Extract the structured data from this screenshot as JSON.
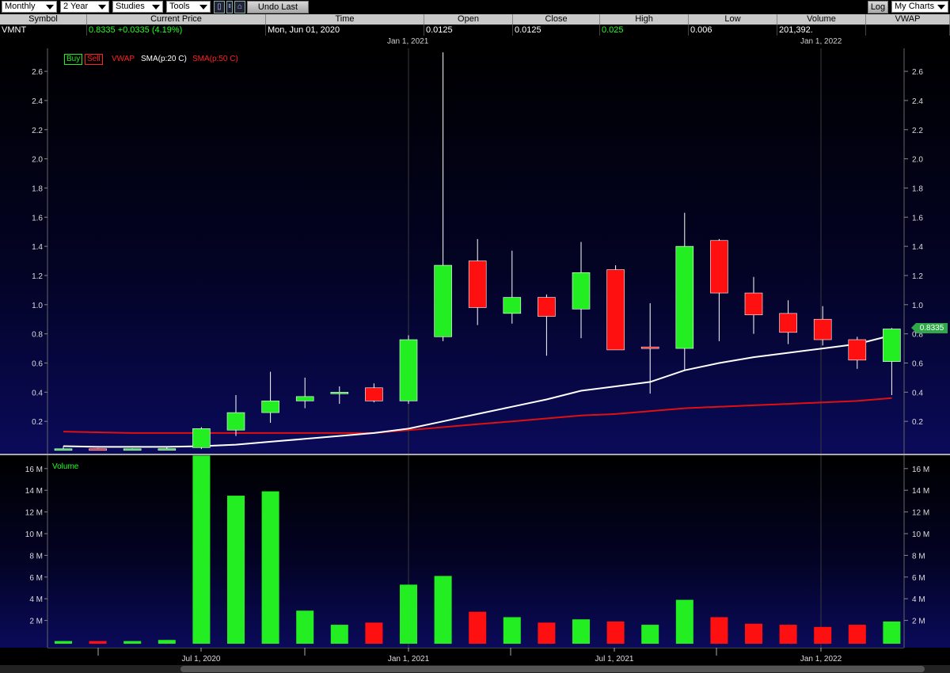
{
  "toolbar": {
    "period": "Monthly",
    "range": "2 Year",
    "studies": "Studies",
    "tools": "Tools",
    "undo": "Undo Last",
    "log": "Log",
    "my_charts": "My Charts"
  },
  "quote": {
    "headers": [
      "Symbol",
      "Current Price",
      "Time",
      "Open",
      "Close",
      "High",
      "Low",
      "Volume",
      "VWAP"
    ],
    "symbol": "VMNT",
    "current_price": "0.8335  +0.0335 (4.19%)",
    "time": "Mon, Jun 01, 2020",
    "open": "0.0125",
    "close": "0.0125",
    "high": "0.025",
    "low": "0.006",
    "volume": "201,392.",
    "vwap": ""
  },
  "legend": {
    "buy": "Buy",
    "sell": "Sell",
    "vwap": "VWAP",
    "sma20": "SMA(p:20 C)",
    "sma50": "SMA(p:50 C)",
    "volume": "Volume"
  },
  "price_tag": "0.8335",
  "top_dates": [
    "Jan 1, 2021",
    "Jan 1, 2022"
  ],
  "bottom_dates": [
    "Jul 1, 2020",
    "Jan 1, 2021",
    "Jul 1, 2021",
    "Jan 1, 2022"
  ],
  "colors": {
    "up": "#22ee22",
    "down": "#ff1010",
    "sma20": "#ffffff",
    "sma50": "#e01010"
  },
  "chart_data": {
    "type": "candlestick",
    "price_axis": {
      "min": 0,
      "max": 2.7,
      "ticks": [
        "0.2",
        "0.4",
        "0.6",
        "0.8",
        "1.0",
        "1.2",
        "1.4",
        "1.6",
        "1.8",
        "2.0",
        "2.2",
        "2.4",
        "2.6"
      ]
    },
    "volume_axis": {
      "max_millions": 17,
      "ticks": [
        "2 M",
        "4 M",
        "6 M",
        "8 M",
        "10 M",
        "12 M",
        "14 M",
        "16 M"
      ]
    },
    "months": [
      "2020-02",
      "2020-03",
      "2020-04",
      "2020-05",
      "2020-06",
      "2020-07",
      "2020-08",
      "2020-09",
      "2020-10",
      "2020-11",
      "2020-12",
      "2021-01",
      "2021-02",
      "2021-03",
      "2021-04",
      "2021-05",
      "2021-06",
      "2021-07",
      "2021-08",
      "2021-09",
      "2021-10",
      "2021-11",
      "2021-12",
      "2022-01",
      "2022-02",
      "2022-03"
    ],
    "candles": [
      {
        "o": 0.01,
        "h": 0.03,
        "l": 0.005,
        "c": 0.012
      },
      {
        "o": 0.012,
        "h": 0.015,
        "l": 0.005,
        "c": 0.01
      },
      {
        "o": 0.01,
        "h": 0.015,
        "l": 0.005,
        "c": 0.012
      },
      {
        "o": 0.0125,
        "h": 0.025,
        "l": 0.006,
        "c": 0.0125
      },
      {
        "o": 0.02,
        "h": 0.16,
        "l": 0.01,
        "c": 0.15
      },
      {
        "o": 0.14,
        "h": 0.38,
        "l": 0.1,
        "c": 0.26
      },
      {
        "o": 0.26,
        "h": 0.54,
        "l": 0.19,
        "c": 0.34
      },
      {
        "o": 0.34,
        "h": 0.5,
        "l": 0.29,
        "c": 0.37
      },
      {
        "o": 0.4,
        "h": 0.44,
        "l": 0.32,
        "c": 0.4
      },
      {
        "o": 0.43,
        "h": 0.46,
        "l": 0.33,
        "c": 0.34
      },
      {
        "o": 0.34,
        "h": 0.79,
        "l": 0.32,
        "c": 0.76
      },
      {
        "o": 0.78,
        "h": 2.73,
        "l": 0.75,
        "c": 1.27
      },
      {
        "o": 1.3,
        "h": 1.45,
        "l": 0.86,
        "c": 0.98
      },
      {
        "o": 0.94,
        "h": 1.37,
        "l": 0.87,
        "c": 1.05
      },
      {
        "o": 1.05,
        "h": 1.07,
        "l": 0.65,
        "c": 0.92
      },
      {
        "o": 0.97,
        "h": 1.43,
        "l": 0.77,
        "c": 1.22
      },
      {
        "o": 1.24,
        "h": 1.27,
        "l": 0.69,
        "c": 0.69
      },
      {
        "o": 0.71,
        "h": 1.01,
        "l": 0.39,
        "c": 0.7
      },
      {
        "o": 0.7,
        "h": 1.63,
        "l": 0.55,
        "c": 1.4
      },
      {
        "o": 1.44,
        "h": 1.45,
        "l": 0.75,
        "c": 1.08
      },
      {
        "o": 1.08,
        "h": 1.19,
        "l": 0.8,
        "c": 0.93
      },
      {
        "o": 0.94,
        "h": 1.03,
        "l": 0.73,
        "c": 0.81
      },
      {
        "o": 0.9,
        "h": 0.99,
        "l": 0.72,
        "c": 0.76
      },
      {
        "o": 0.76,
        "h": 0.78,
        "l": 0.56,
        "c": 0.62
      },
      {
        "o": 0.61,
        "h": 0.84,
        "l": 0.38,
        "c": 0.8335
      }
    ],
    "volume_millions": [
      0.1,
      0.1,
      0.1,
      0.2,
      17.2,
      13.5,
      13.9,
      2.9,
      1.6,
      1.8,
      5.3,
      6.1,
      2.8,
      2.3,
      1.8,
      2.1,
      1.9,
      1.6,
      3.9,
      2.3,
      1.7,
      1.6,
      1.4,
      1.6,
      1.9
    ],
    "volume_up": [
      true,
      false,
      true,
      true,
      true,
      true,
      true,
      true,
      true,
      false,
      true,
      true,
      false,
      true,
      false,
      true,
      false,
      true,
      true,
      false,
      false,
      false,
      false,
      false,
      true
    ],
    "sma20": [
      0.03,
      0.025,
      0.025,
      0.025,
      0.03,
      0.04,
      0.06,
      0.08,
      0.1,
      0.12,
      0.15,
      0.2,
      0.25,
      0.3,
      0.35,
      0.41,
      0.44,
      0.47,
      0.55,
      0.6,
      0.64,
      0.67,
      0.7,
      0.73,
      0.79
    ],
    "sma50": [
      0.13,
      0.125,
      0.12,
      0.12,
      0.12,
      0.12,
      0.12,
      0.12,
      0.12,
      0.12,
      0.14,
      0.16,
      0.18,
      0.2,
      0.22,
      0.24,
      0.25,
      0.27,
      0.29,
      0.3,
      0.31,
      0.32,
      0.33,
      0.34,
      0.36
    ]
  }
}
